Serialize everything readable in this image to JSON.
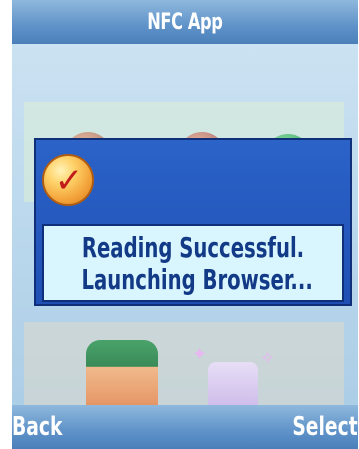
{
  "app": {
    "title": "NFC App"
  },
  "dialog": {
    "icon": "checkmark-icon",
    "message_line1": "Reading Successful.",
    "message_line2": "Launching Browser..."
  },
  "softkeys": {
    "left_label": "Back",
    "right_label": "Select"
  },
  "colors": {
    "title_bar": "#5e92c8",
    "dialog_frame": "#1f4fb5",
    "message_background": "#d9f6ff",
    "message_text": "#123a86",
    "check_red": "#c21b1b",
    "check_orange": "#f3a33a"
  }
}
